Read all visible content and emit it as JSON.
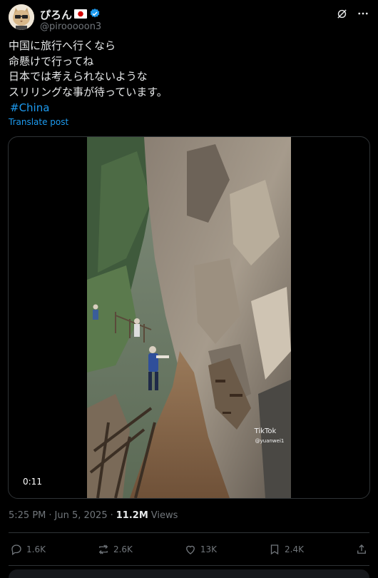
{
  "user": {
    "display_name": "ぴろん",
    "handle": "@pirooooon3",
    "avatar_icon": "cat-avatar-icon",
    "flag_icon": "japan-flag-icon",
    "verified_icon": "verified-badge-icon"
  },
  "header": {
    "grok_icon": "grok-icon",
    "more_icon": "more-icon"
  },
  "post": {
    "text": "中国に旅行へ行くなら\n命懸けで行ってね\n日本では考えられないような\nスリリングな事が待っています。",
    "hashtag": "#China",
    "translate_label": "Translate post"
  },
  "media": {
    "duration": "0:11",
    "watermark": "TikTok",
    "watermark_handle": "@yuanwei1"
  },
  "meta": {
    "time": "5:25 PM",
    "separator1": "·",
    "date": "Jun 5, 2025",
    "separator2": "·",
    "views_count": "11.2M",
    "views_label": "Views"
  },
  "actions": {
    "replies": "1.6K",
    "reposts": "2.6K",
    "likes": "13K",
    "bookmarks": "2.4K"
  },
  "colors": {
    "accent": "#1d9bf0",
    "muted": "#71767b",
    "text": "#e7e9ea",
    "border": "#2f3336"
  }
}
